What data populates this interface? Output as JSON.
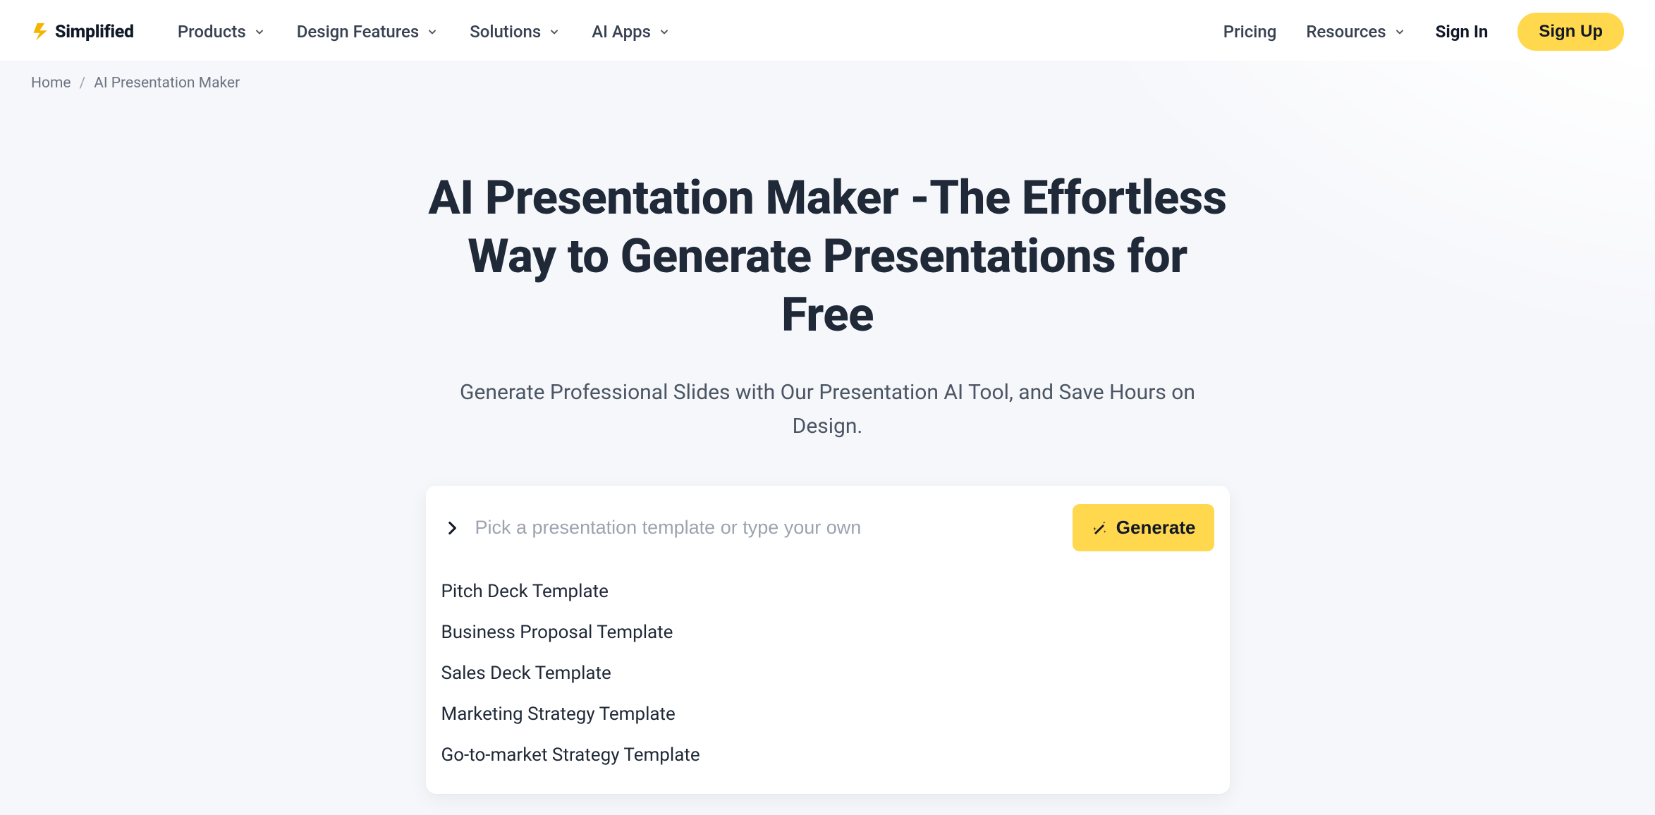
{
  "brand": {
    "name": "Simplified"
  },
  "nav": {
    "items": [
      {
        "label": "Products"
      },
      {
        "label": "Design Features"
      },
      {
        "label": "Solutions"
      },
      {
        "label": "AI Apps"
      }
    ],
    "pricing": "Pricing",
    "resources": "Resources",
    "signin": "Sign In",
    "signup": "Sign Up"
  },
  "breadcrumb": {
    "home": "Home",
    "current": "AI Presentation Maker"
  },
  "hero": {
    "title": "AI Presentation Maker -The Effortless Way to Generate Presentations for Free",
    "subtitle": "Generate Professional Slides with Our Presentation AI Tool, and Save Hours on Design."
  },
  "prompt": {
    "placeholder": "Pick a presentation template or type your own",
    "value": "",
    "generate_label": "Generate",
    "suggestions": [
      "Pitch Deck Template",
      "Business Proposal Template",
      "Sales Deck Template",
      "Marketing Strategy Template",
      "Go-to-market Strategy Template"
    ]
  }
}
